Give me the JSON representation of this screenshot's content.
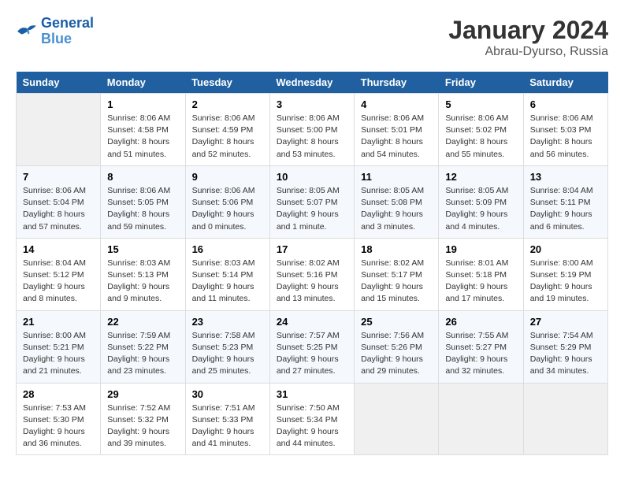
{
  "logo": {
    "line1": "General",
    "line2": "Blue"
  },
  "title": "January 2024",
  "subtitle": "Abrau-Dyurso, Russia",
  "weekdays": [
    "Sunday",
    "Monday",
    "Tuesday",
    "Wednesday",
    "Thursday",
    "Friday",
    "Saturday"
  ],
  "weeks": [
    [
      {
        "day": "",
        "info": ""
      },
      {
        "day": "1",
        "info": "Sunrise: 8:06 AM\nSunset: 4:58 PM\nDaylight: 8 hours\nand 51 minutes."
      },
      {
        "day": "2",
        "info": "Sunrise: 8:06 AM\nSunset: 4:59 PM\nDaylight: 8 hours\nand 52 minutes."
      },
      {
        "day": "3",
        "info": "Sunrise: 8:06 AM\nSunset: 5:00 PM\nDaylight: 8 hours\nand 53 minutes."
      },
      {
        "day": "4",
        "info": "Sunrise: 8:06 AM\nSunset: 5:01 PM\nDaylight: 8 hours\nand 54 minutes."
      },
      {
        "day": "5",
        "info": "Sunrise: 8:06 AM\nSunset: 5:02 PM\nDaylight: 8 hours\nand 55 minutes."
      },
      {
        "day": "6",
        "info": "Sunrise: 8:06 AM\nSunset: 5:03 PM\nDaylight: 8 hours\nand 56 minutes."
      }
    ],
    [
      {
        "day": "7",
        "info": "Sunrise: 8:06 AM\nSunset: 5:04 PM\nDaylight: 8 hours\nand 57 minutes."
      },
      {
        "day": "8",
        "info": "Sunrise: 8:06 AM\nSunset: 5:05 PM\nDaylight: 8 hours\nand 59 minutes."
      },
      {
        "day": "9",
        "info": "Sunrise: 8:06 AM\nSunset: 5:06 PM\nDaylight: 9 hours\nand 0 minutes."
      },
      {
        "day": "10",
        "info": "Sunrise: 8:05 AM\nSunset: 5:07 PM\nDaylight: 9 hours\nand 1 minute."
      },
      {
        "day": "11",
        "info": "Sunrise: 8:05 AM\nSunset: 5:08 PM\nDaylight: 9 hours\nand 3 minutes."
      },
      {
        "day": "12",
        "info": "Sunrise: 8:05 AM\nSunset: 5:09 PM\nDaylight: 9 hours\nand 4 minutes."
      },
      {
        "day": "13",
        "info": "Sunrise: 8:04 AM\nSunset: 5:11 PM\nDaylight: 9 hours\nand 6 minutes."
      }
    ],
    [
      {
        "day": "14",
        "info": "Sunrise: 8:04 AM\nSunset: 5:12 PM\nDaylight: 9 hours\nand 8 minutes."
      },
      {
        "day": "15",
        "info": "Sunrise: 8:03 AM\nSunset: 5:13 PM\nDaylight: 9 hours\nand 9 minutes."
      },
      {
        "day": "16",
        "info": "Sunrise: 8:03 AM\nSunset: 5:14 PM\nDaylight: 9 hours\nand 11 minutes."
      },
      {
        "day": "17",
        "info": "Sunrise: 8:02 AM\nSunset: 5:16 PM\nDaylight: 9 hours\nand 13 minutes."
      },
      {
        "day": "18",
        "info": "Sunrise: 8:02 AM\nSunset: 5:17 PM\nDaylight: 9 hours\nand 15 minutes."
      },
      {
        "day": "19",
        "info": "Sunrise: 8:01 AM\nSunset: 5:18 PM\nDaylight: 9 hours\nand 17 minutes."
      },
      {
        "day": "20",
        "info": "Sunrise: 8:00 AM\nSunset: 5:19 PM\nDaylight: 9 hours\nand 19 minutes."
      }
    ],
    [
      {
        "day": "21",
        "info": "Sunrise: 8:00 AM\nSunset: 5:21 PM\nDaylight: 9 hours\nand 21 minutes."
      },
      {
        "day": "22",
        "info": "Sunrise: 7:59 AM\nSunset: 5:22 PM\nDaylight: 9 hours\nand 23 minutes."
      },
      {
        "day": "23",
        "info": "Sunrise: 7:58 AM\nSunset: 5:23 PM\nDaylight: 9 hours\nand 25 minutes."
      },
      {
        "day": "24",
        "info": "Sunrise: 7:57 AM\nSunset: 5:25 PM\nDaylight: 9 hours\nand 27 minutes."
      },
      {
        "day": "25",
        "info": "Sunrise: 7:56 AM\nSunset: 5:26 PM\nDaylight: 9 hours\nand 29 minutes."
      },
      {
        "day": "26",
        "info": "Sunrise: 7:55 AM\nSunset: 5:27 PM\nDaylight: 9 hours\nand 32 minutes."
      },
      {
        "day": "27",
        "info": "Sunrise: 7:54 AM\nSunset: 5:29 PM\nDaylight: 9 hours\nand 34 minutes."
      }
    ],
    [
      {
        "day": "28",
        "info": "Sunrise: 7:53 AM\nSunset: 5:30 PM\nDaylight: 9 hours\nand 36 minutes."
      },
      {
        "day": "29",
        "info": "Sunrise: 7:52 AM\nSunset: 5:32 PM\nDaylight: 9 hours\nand 39 minutes."
      },
      {
        "day": "30",
        "info": "Sunrise: 7:51 AM\nSunset: 5:33 PM\nDaylight: 9 hours\nand 41 minutes."
      },
      {
        "day": "31",
        "info": "Sunrise: 7:50 AM\nSunset: 5:34 PM\nDaylight: 9 hours\nand 44 minutes."
      },
      {
        "day": "",
        "info": ""
      },
      {
        "day": "",
        "info": ""
      },
      {
        "day": "",
        "info": ""
      }
    ]
  ]
}
